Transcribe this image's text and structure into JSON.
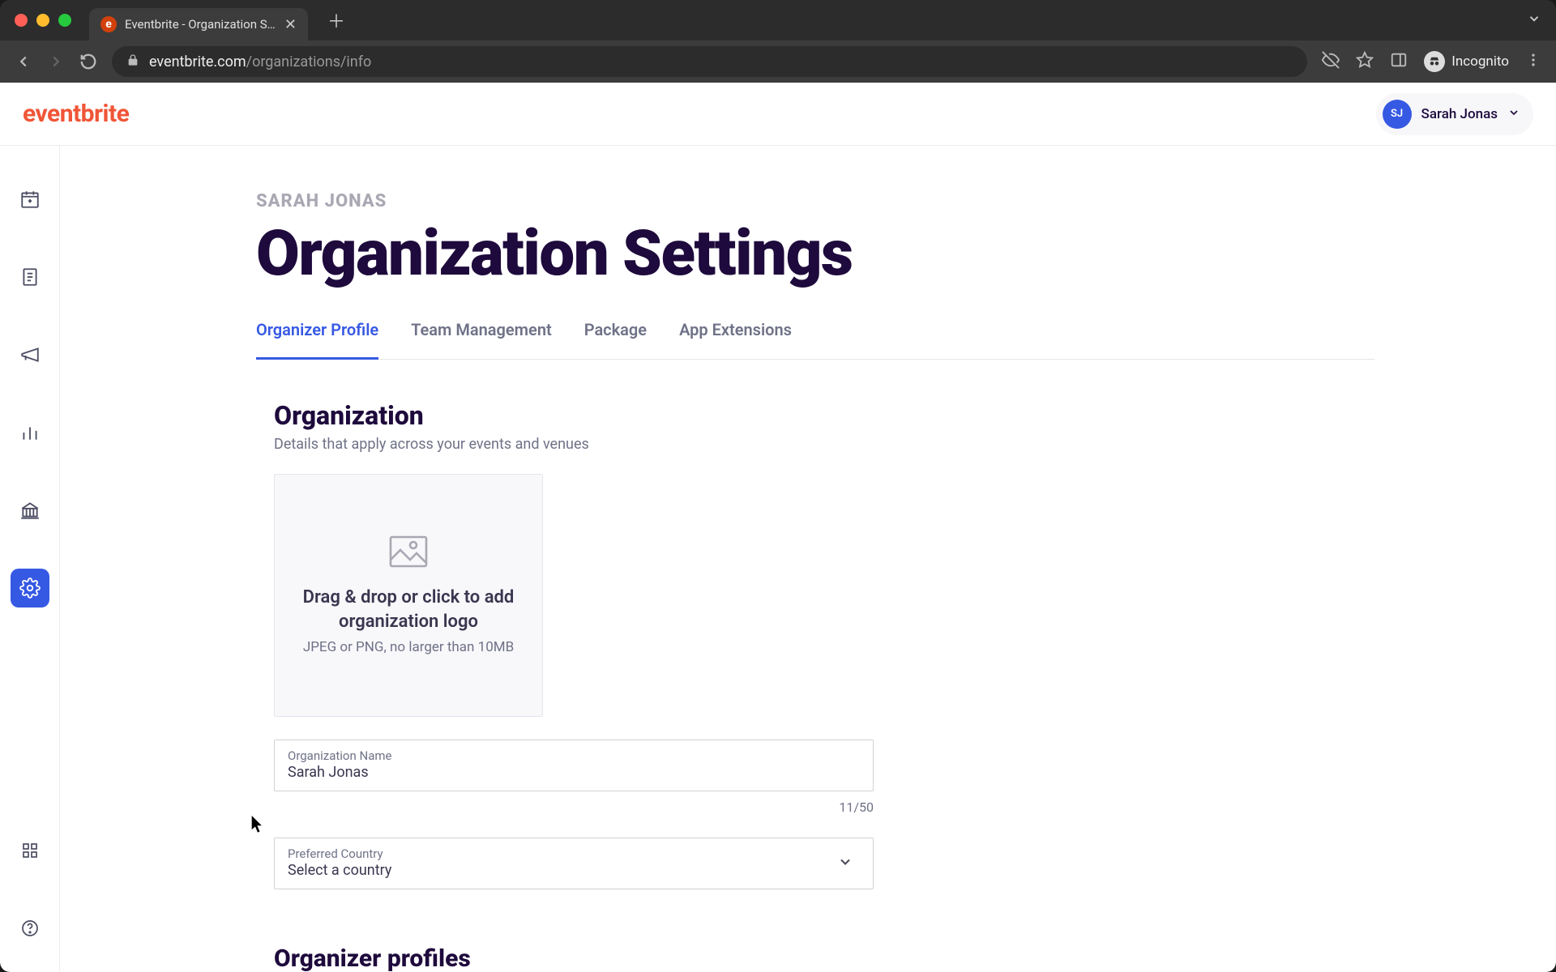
{
  "browser": {
    "tab_title": "Eventbrite - Organization Setti",
    "favicon_letter": "e",
    "url_domain": "eventbrite.com",
    "url_path": "/organizations/info",
    "incognito_label": "Incognito"
  },
  "header": {
    "logo": "eventbrite",
    "user": {
      "initials": "SJ",
      "name": "Sarah Jonas"
    }
  },
  "sidebar": {
    "items": [
      {
        "name": "calendar",
        "active": false
      },
      {
        "name": "list",
        "active": false
      },
      {
        "name": "megaphone",
        "active": false
      },
      {
        "name": "reports",
        "active": false
      },
      {
        "name": "finance",
        "active": false
      },
      {
        "name": "settings",
        "active": true
      }
    ],
    "bottom_items": [
      {
        "name": "apps"
      },
      {
        "name": "help"
      }
    ]
  },
  "page": {
    "eyebrow": "SARAH JONAS",
    "title": "Organization Settings",
    "tabs": [
      {
        "label": "Organizer Profile",
        "active": true
      },
      {
        "label": "Team Management",
        "active": false
      },
      {
        "label": "Package",
        "active": false
      },
      {
        "label": "App Extensions",
        "active": false
      }
    ],
    "section1": {
      "title": "Organization",
      "subtitle": "Details that apply across your events and venues",
      "upload": {
        "title": "Drag & drop or click to add organization logo",
        "subtitle": "JPEG or PNG, no larger than 10MB"
      },
      "org_name": {
        "label": "Organization Name",
        "value": "Sarah Jonas",
        "char_count": "11/50"
      },
      "country": {
        "label": "Preferred Country",
        "value": "Select a country"
      }
    },
    "section2": {
      "title": "Organizer profiles"
    }
  }
}
